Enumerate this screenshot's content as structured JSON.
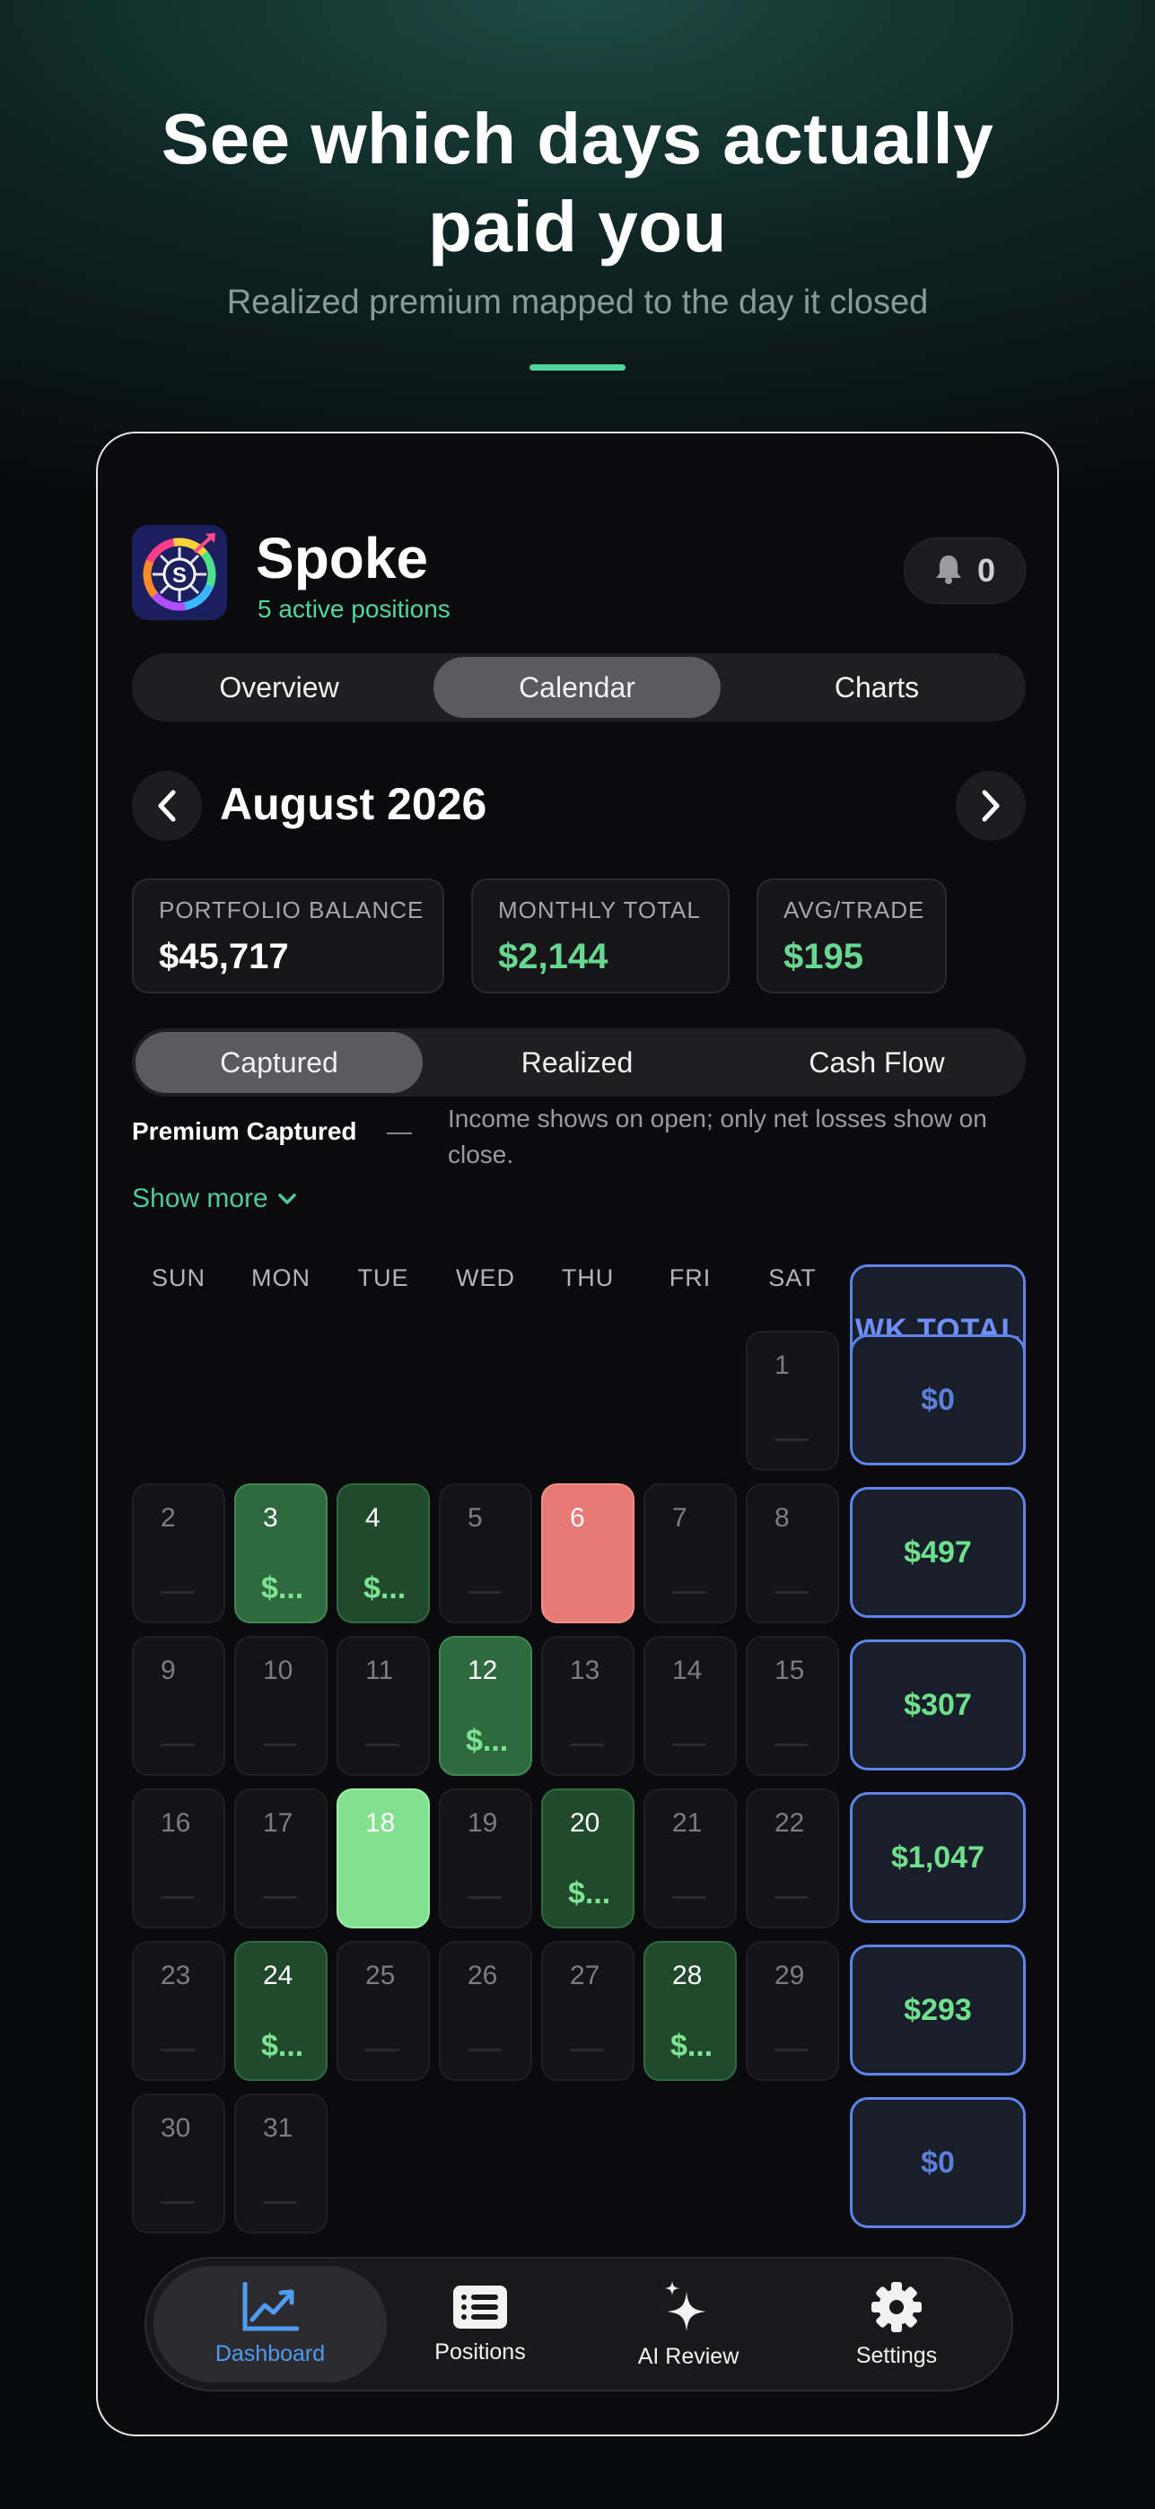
{
  "hero": {
    "title_line1": "See which days actually",
    "title_line2": "paid you",
    "subtitle": "Realized premium mapped to the day it closed"
  },
  "app": {
    "name": "Spoke",
    "subtitle": "5 active positions",
    "notification_count": "0",
    "logo_letter": "S"
  },
  "view_tabs": [
    "Overview",
    "Calendar",
    "Charts"
  ],
  "view_tab_active": "Calendar",
  "month": "August 2026",
  "stats": [
    {
      "label": "PORTFOLIO BALANCE",
      "value": "$45,717"
    },
    {
      "label": "MONTHLY TOTAL",
      "value": "$2,144"
    },
    {
      "label": "AVG/TRADE",
      "value": "$195"
    }
  ],
  "mode_tabs": [
    "Captured",
    "Realized",
    "Cash Flow"
  ],
  "mode_tab_active": "Captured",
  "note": {
    "strong": "Premium Captured",
    "dash": "—",
    "description": "Income shows on open; only net losses show on close."
  },
  "show_more": "Show more",
  "weekdays": [
    "SUN",
    "MON",
    "TUE",
    "WED",
    "THU",
    "FRI",
    "SAT",
    "WK TOTAL"
  ],
  "calendar_days": [
    {
      "day": "1",
      "amount": "",
      "style": "empty"
    },
    {
      "day": "2",
      "amount": "",
      "style": "empty"
    },
    {
      "day": "3",
      "amount": "$...",
      "style": "gain"
    },
    {
      "day": "4",
      "amount": "$...",
      "style": "gain-dark"
    },
    {
      "day": "5",
      "amount": "",
      "style": "empty"
    },
    {
      "day": "6",
      "amount": "",
      "style": "loss"
    },
    {
      "day": "7",
      "amount": "",
      "style": "empty"
    },
    {
      "day": "8",
      "amount": "",
      "style": "empty"
    },
    {
      "day": "9",
      "amount": "",
      "style": "empty"
    },
    {
      "day": "10",
      "amount": "",
      "style": "empty"
    },
    {
      "day": "11",
      "amount": "",
      "style": "empty"
    },
    {
      "day": "12",
      "amount": "$...",
      "style": "gain"
    },
    {
      "day": "13",
      "amount": "",
      "style": "empty"
    },
    {
      "day": "14",
      "amount": "",
      "style": "empty"
    },
    {
      "day": "15",
      "amount": "",
      "style": "empty"
    },
    {
      "day": "16",
      "amount": "",
      "style": "empty"
    },
    {
      "day": "17",
      "amount": "",
      "style": "empty"
    },
    {
      "day": "18",
      "amount": "",
      "style": "gain-bright"
    },
    {
      "day": "19",
      "amount": "",
      "style": "empty"
    },
    {
      "day": "20",
      "amount": "$...",
      "style": "gain-dark"
    },
    {
      "day": "21",
      "amount": "",
      "style": "empty"
    },
    {
      "day": "22",
      "amount": "",
      "style": "empty"
    },
    {
      "day": "23",
      "amount": "",
      "style": "empty"
    },
    {
      "day": "24",
      "amount": "$...",
      "style": "gain-dark"
    },
    {
      "day": "25",
      "amount": "",
      "style": "empty"
    },
    {
      "day": "26",
      "amount": "",
      "style": "empty"
    },
    {
      "day": "27",
      "amount": "",
      "style": "empty"
    },
    {
      "day": "28",
      "amount": "$...",
      "style": "gain-dark"
    },
    {
      "day": "29",
      "amount": "",
      "style": "empty"
    },
    {
      "day": "30",
      "amount": "",
      "style": "empty"
    },
    {
      "day": "31",
      "amount": "",
      "style": "empty"
    }
  ],
  "first_weekday_index": 6,
  "week_totals": [
    "$0",
    "$497",
    "$307",
    "$1,047",
    "$293",
    "$0"
  ],
  "bottom_tabs": [
    {
      "label": "Dashboard",
      "icon": "chart-line-icon"
    },
    {
      "label": "Positions",
      "icon": "list-icon"
    },
    {
      "label": "AI Review",
      "icon": "sparkles-icon"
    },
    {
      "label": "Settings",
      "icon": "gear-icon"
    }
  ],
  "bottom_tab_active": "Dashboard",
  "colors": {
    "accent_green": "#4ed79a",
    "gain": "#2f6a3e",
    "gain_dark": "#214a2d",
    "gain_bright": "#83e08f",
    "loss": "#e77a75",
    "week_border": "#5f83e8",
    "active_tab_blue": "#4f9bf0"
  }
}
